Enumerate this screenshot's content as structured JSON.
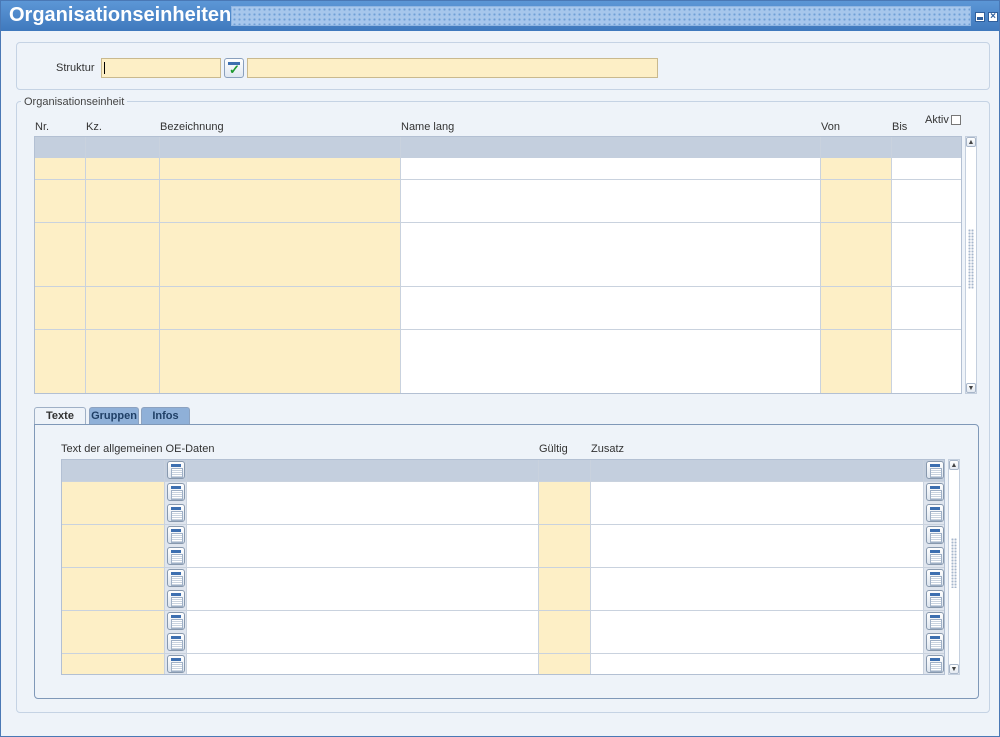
{
  "window": {
    "title": "Organisationseinheiten"
  },
  "struktur": {
    "label": "Struktur",
    "code_value": "",
    "name_value": ""
  },
  "org_section": {
    "legend": "Organisationseinheit",
    "columns": [
      "Nr.",
      "Kz.",
      "Bezeichnung",
      "Name lang",
      "Von",
      "Bis"
    ],
    "aktiv_label": "Aktiv",
    "aktiv_checked": false,
    "row_count": 11
  },
  "tabs": [
    {
      "label": "Texte",
      "active": true
    },
    {
      "label": "Gruppen",
      "active": false
    },
    {
      "label": "Infos",
      "active": false
    }
  ],
  "text_section": {
    "columns": [
      "Text der allgemeinen OE-Daten",
      "Gültig",
      "Zusatz"
    ],
    "row_count": 10
  },
  "icons": {
    "minimize": "minimize-icon",
    "close": "close-icon",
    "struktur_lov": "calendar-check-icon",
    "cell_editor": "editor-icon",
    "scroll_up": "arrow-up-icon",
    "scroll_down": "arrow-down-icon"
  },
  "colors": {
    "title_bar": "#4a86c8",
    "required_field": "#fdefc6",
    "header_row": "#c4cfde",
    "tab_inactive": "#8fb0d8"
  }
}
